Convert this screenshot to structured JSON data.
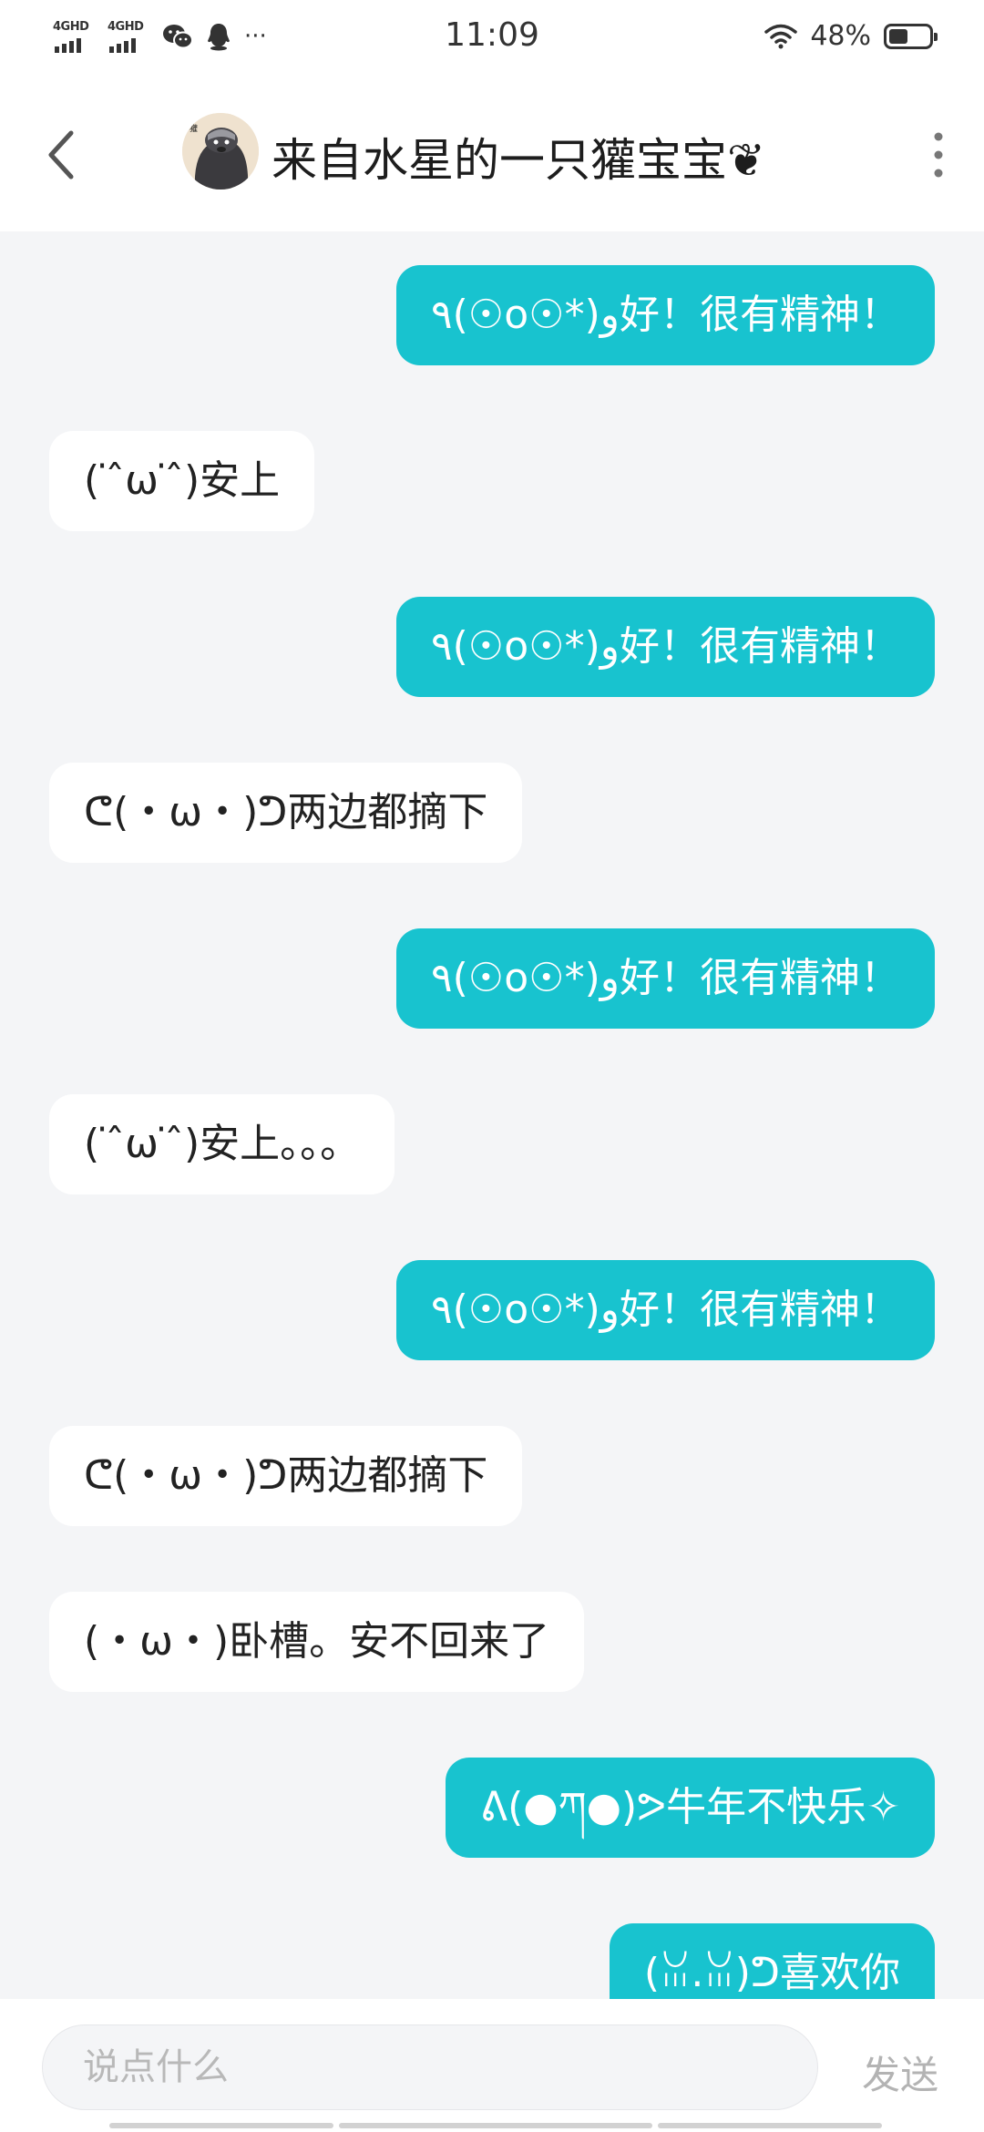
{
  "status_bar": {
    "network_1": "4GHD",
    "network_2": "4GHD",
    "more": "···",
    "time": "11:09",
    "battery": "48%",
    "battery_level": 0.48
  },
  "header": {
    "title": "来自水星的一只獾宝宝❦"
  },
  "messages": [
    {
      "dir": "out",
      "text": "٩(☉o☉*)و好！很有精神！"
    },
    {
      "dir": "in",
      "text": "( ̇ ̂ω ̇ ̂)安上"
    },
    {
      "dir": "out",
      "text": "٩(☉o☉*)و好！很有精神！"
    },
    {
      "dir": "in",
      "text": "ᕦ(・ω・)ᕤ两边都摘下"
    },
    {
      "dir": "out",
      "text": "٩(☉o☉*)و好！很有精神！"
    },
    {
      "dir": "in",
      "text": "( ̇ ̂ω ̇ ̂)安上。。。"
    },
    {
      "dir": "out",
      "text": "٩(☉o☉*)و好！很有精神！"
    },
    {
      "dir": "in",
      "text": "ᕦ(・ω・)ᕤ两边都摘下"
    },
    {
      "dir": "in",
      "text": "(・ω・)卧槽。安不回来了"
    },
    {
      "dir": "out",
      "text": "ᕕ(●ཀ●)ᕗ牛年不快乐✧"
    },
    {
      "dir": "out",
      "text": "(ꈍ.ꈍ)ᕤ喜欢你"
    }
  ],
  "input": {
    "placeholder": "说点什么",
    "send_label": "发送"
  },
  "colors": {
    "outgoing_bubble": "#18c3cf",
    "incoming_bubble": "#ffffff",
    "background": "#f4f5f7"
  }
}
